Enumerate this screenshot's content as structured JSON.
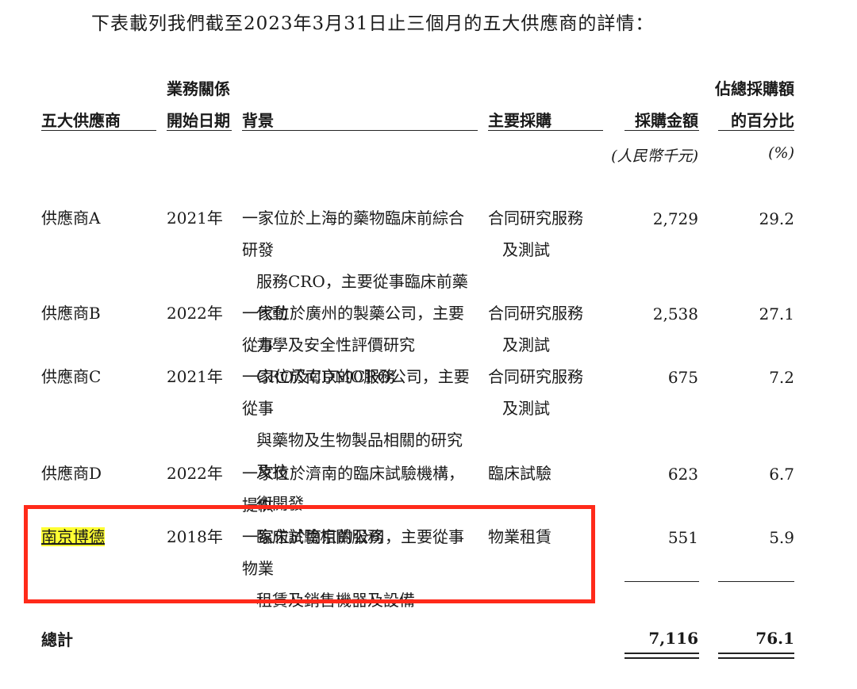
{
  "intro": "下表載列我們截至2023年3月31日止三個月的五大供應商的詳情：",
  "headers": {
    "supplier": "五大供應商",
    "start_date_l1": "業務關係",
    "start_date_l2": "開始日期",
    "background": "背景",
    "purchase": "主要採購",
    "amount": "採購金額",
    "pct_l1": "佔總採購額",
    "pct_l2": "的百分比"
  },
  "units": {
    "amount": "(人民幣千元)",
    "pct": "(%)"
  },
  "rows": [
    {
      "supplier": "供應商A",
      "year": "2021年",
      "desc": [
        "一家位於上海的藥物臨床前綜合研發",
        "服務CRO，主要從事臨床前藥代動",
        "力學及安全性評價研究"
      ],
      "purchase": [
        "合同研究服務",
        "及測試"
      ],
      "amount": "2,729",
      "pct": "29.2"
    },
    {
      "supplier": "供應商B",
      "year": "2022年",
      "desc": [
        "一家位於廣州的製藥公司，主要從事",
        "CRO及CDMO服務"
      ],
      "purchase": [
        "合同研究服務",
        "及測試"
      ],
      "amount": "2,538",
      "pct": "27.1"
    },
    {
      "supplier": "供應商C",
      "year": "2021年",
      "desc": [
        "一家位於南京的CRO公司，主要從事",
        "與藥物及生物製品相關的研究及技",
        "術開發"
      ],
      "purchase": [
        "合同研究服務",
        "及測試"
      ],
      "amount": "675",
      "pct": "7.2"
    },
    {
      "supplier": "供應商D",
      "year": "2022年",
      "desc": [
        "一家位於濟南的臨床試驗機構，提供",
        "臨床試驗相關服務"
      ],
      "purchase": [
        "臨床試驗"
      ],
      "amount": "623",
      "pct": "6.7"
    },
    {
      "supplier": "南京博德",
      "year": "2018年",
      "desc": [
        "一家位於南京的公司，主要從事物業",
        "租賃及銷售機器及設備"
      ],
      "purchase": [
        "物業租賃"
      ],
      "amount": "551",
      "pct": "5.9"
    }
  ],
  "total": {
    "label": "總計",
    "amount": "7,116",
    "pct": "76.1"
  },
  "colors": {
    "highlight": "#ffff33",
    "annotation_box": "#ff2a1a"
  }
}
